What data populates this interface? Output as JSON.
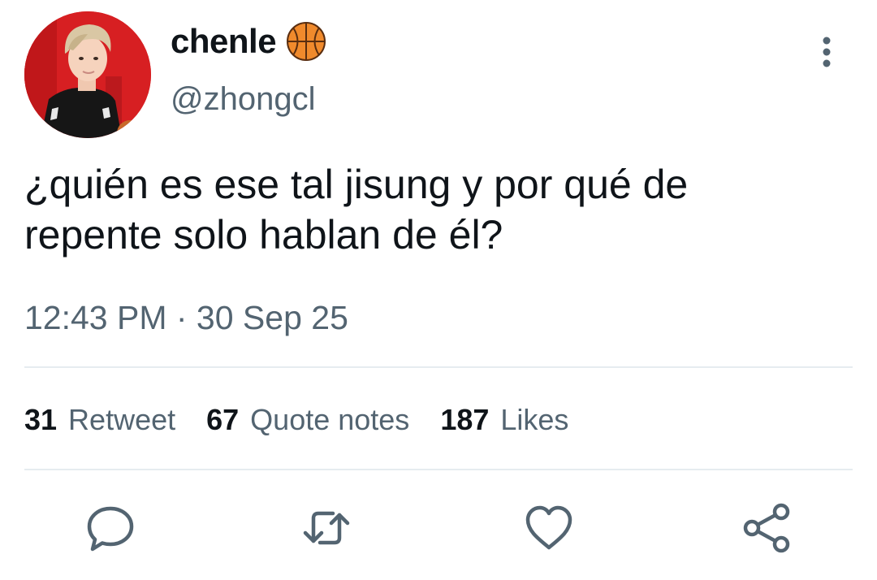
{
  "profile": {
    "display_name": "chenle",
    "name_emoji_icon": "basketball-icon",
    "handle": "@zhongcl",
    "avatar_icon": "profile-photo"
  },
  "tweet": {
    "text": "¿quién es ese tal jisung y por qué de repente solo hablan de él?",
    "timestamp": "12:43 PM · 30 Sep 25"
  },
  "stats": [
    {
      "count": "31",
      "label": "Retweet"
    },
    {
      "count": "67",
      "label": "Quote notes"
    },
    {
      "count": "187",
      "label": "Likes"
    }
  ],
  "actions": [
    {
      "icon": "reply-icon"
    },
    {
      "icon": "retweet-icon"
    },
    {
      "icon": "like-icon"
    },
    {
      "icon": "share-icon"
    }
  ],
  "menu_icon": "more-options-icon",
  "colors": {
    "text_primary": "#0f1419",
    "text_secondary": "#536471",
    "divider": "#e6ecf0",
    "avatar_background": "#d71f22"
  }
}
